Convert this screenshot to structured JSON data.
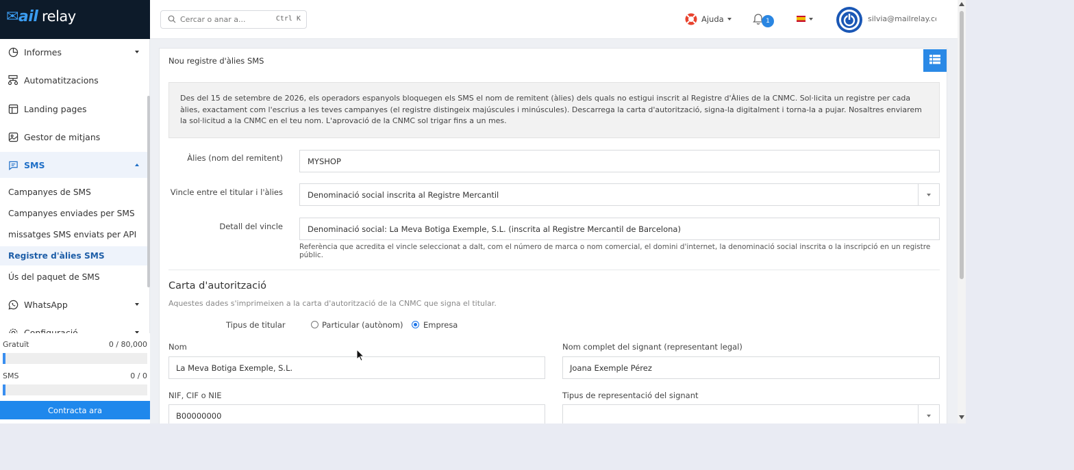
{
  "brand": {
    "logo_prefix": "Mail",
    "logo_accent": "ail",
    "logo_suffix": "relay",
    "logo_text": "Mailrelay"
  },
  "sidebar": {
    "items": [
      {
        "label": "Informes",
        "icon": "pie-chart-icon"
      },
      {
        "label": "Automatitzacions",
        "icon": "workflow-icon"
      },
      {
        "label": "Landing pages",
        "icon": "layout-icon"
      },
      {
        "label": "Gestor de mitjans",
        "icon": "image-icon"
      },
      {
        "label": "SMS",
        "icon": "message-icon"
      },
      {
        "label": "WhatsApp",
        "icon": "whatsapp-icon"
      },
      {
        "label": "Configuració",
        "icon": "gear-icon"
      }
    ],
    "sms_sub": [
      "Campanyes de SMS",
      "Campanyes enviades per SMS",
      "missatges SMS enviats per API",
      "Registre d'àlies SMS",
      "Ús del paquet de SMS"
    ]
  },
  "usage": {
    "free_label": "Gratuït",
    "free_value": "0 / 80,000",
    "free_fill": 0.02,
    "sms_label": "SMS",
    "sms_value": "0 / 0",
    "sms_fill": 0.02,
    "cta": "Contracta ara"
  },
  "topbar": {
    "search_placeholder": "Cercar o anar a...",
    "search_shortcut": "Ctrl K",
    "help_label": "Ajuda",
    "notifications_count": "1",
    "user_email": "silvia@mailrelay.com"
  },
  "card": {
    "title": "Nou registre d'àlies SMS",
    "notice": "Des del 15 de setembre de 2026, els operadors espanyols bloquegen els SMS el nom de remitent (àlies) dels quals no estigui inscrit al Registre d'Àlies de la CNMC. Sol·licita un registre per cada àlies, exactament com l'escrius a les teves campanyes (el registre distingeix majúscules i minúscules). Descarrega la carta d'autorització, signa-la digitalment i torna-la a pujar. Nosaltres enviarem la sol·licitud a la CNMC en el teu nom. L'aprovació de la CNMC sol trigar fins a un mes.",
    "alias_label": "Àlies (nom del remitent)",
    "alias_value": "MYSHOP",
    "link_label": "Vincle entre el titular i l'àlies",
    "link_value": "Denominació social inscrita al Registre Mercantil",
    "detail_label": "Detall del vincle",
    "detail_value": "Denominació social: La Meva Botiga Exemple, S.L. (inscrita al Registre Mercantil de Barcelona)",
    "detail_help": "Referència que acredita el vincle seleccionat a dalt, com el número de marca o nom comercial, el domini d'internet, la denominació social inscrita o la inscripció en un registre públic.",
    "section_title": "Carta d'autorització",
    "section_subtitle": "Aquestes dades s'imprimeixen a la carta d'autorització de la CNMC que signa el titular.",
    "holder_type_label": "Tipus de titular",
    "holder_options": [
      "Particular (autònom)",
      "Empresa"
    ],
    "holder_selected": "Empresa",
    "name_label": "Nom",
    "name_value": "La Meva Botiga Exemple, S.L.",
    "signer_label": "Nom complet del signant (representant legal)",
    "signer_value": "Joana Exemple Pérez",
    "nif_label": "NIF, CIF o NIE",
    "nif_value": "B00000000",
    "rep_type_label": "Tipus de representació del signant",
    "rep_type_value": ""
  }
}
